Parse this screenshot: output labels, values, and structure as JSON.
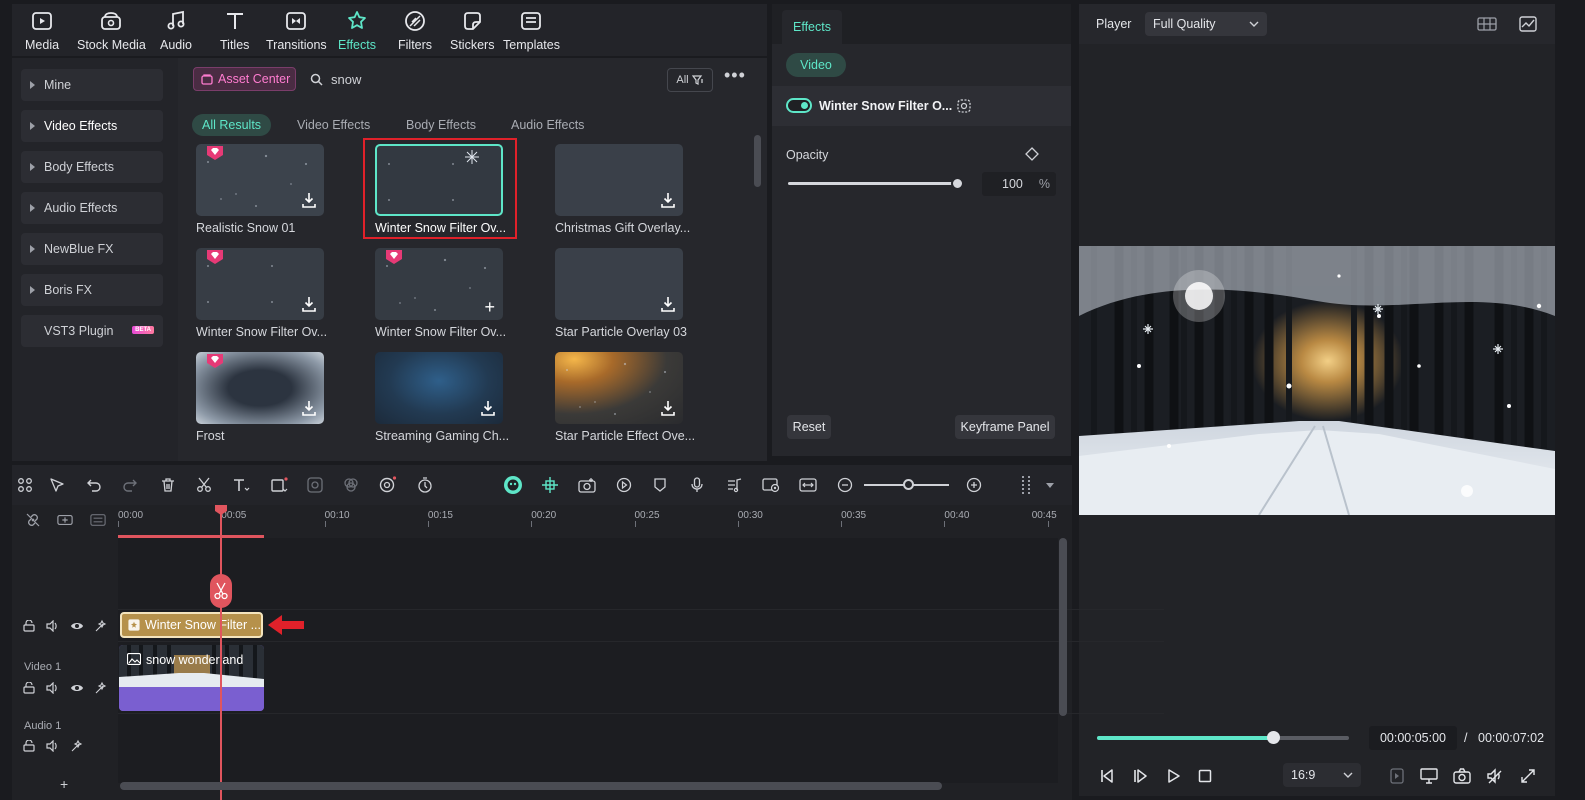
{
  "toolbar": {
    "tabs": [
      {
        "label": "Media",
        "icon": "media-icon"
      },
      {
        "label": "Stock Media",
        "icon": "stock-media-icon"
      },
      {
        "label": "Audio",
        "icon": "audio-icon"
      },
      {
        "label": "Titles",
        "icon": "titles-icon"
      },
      {
        "label": "Transitions",
        "icon": "transitions-icon"
      },
      {
        "label": "Effects",
        "icon": "effects-icon"
      },
      {
        "label": "Filters",
        "icon": "filters-icon"
      },
      {
        "label": "Stickers",
        "icon": "stickers-icon"
      },
      {
        "label": "Templates",
        "icon": "templates-icon"
      }
    ],
    "active": "Effects"
  },
  "sidebar": {
    "items": [
      {
        "label": "Mine"
      },
      {
        "label": "Video Effects"
      },
      {
        "label": "Body Effects"
      },
      {
        "label": "Audio Effects"
      },
      {
        "label": "NewBlue FX"
      },
      {
        "label": "Boris FX"
      },
      {
        "label": "VST3 Plugin",
        "badge": "BETA"
      }
    ]
  },
  "library": {
    "asset_center": "Asset Center",
    "search_value": "snow",
    "filter_label": "All",
    "filter_tabs": [
      "All Results",
      "Video Effects",
      "Body Effects",
      "Audio Effects"
    ],
    "cards": [
      {
        "label": "Realistic Snow 01",
        "premium": true,
        "action": "download"
      },
      {
        "label": "Winter Snow Filter Ov...",
        "premium": false,
        "action": "none",
        "selected": true
      },
      {
        "label": "Christmas Gift Overlay...",
        "premium": false,
        "action": "download"
      },
      {
        "label": "Winter Snow Filter Ov...",
        "premium": true,
        "action": "download"
      },
      {
        "label": "Winter Snow Filter Ov...",
        "premium": true,
        "action": "add"
      },
      {
        "label": "Star Particle Overlay 03",
        "premium": false,
        "action": "download"
      },
      {
        "label": "Frost",
        "premium": true,
        "action": "download"
      },
      {
        "label": "Streaming Gaming Ch...",
        "premium": false,
        "action": "download"
      },
      {
        "label": "Star Particle Effect Ove...",
        "premium": false,
        "action": "download"
      }
    ]
  },
  "effects_panel": {
    "tab": "Effects",
    "subtab": "Video",
    "effect_name": "Winter Snow Filter O...",
    "opacity_label": "Opacity",
    "opacity_value": "100",
    "opacity_unit": "%",
    "opacity_fraction": 1.0,
    "reset": "Reset",
    "keyframe": "Keyframe Panel"
  },
  "player": {
    "title": "Player",
    "quality": "Full Quality",
    "current_time": "00:00:05:00",
    "separator": "/",
    "total_time": "00:00:07:02",
    "progress_fraction": 0.7,
    "aspect": "16:9"
  },
  "timeline": {
    "ticks": [
      "00:00",
      "00:05",
      "00:10",
      "00:15",
      "00:20",
      "00:25",
      "00:30",
      "00:35",
      "00:40",
      "00:45"
    ],
    "effect_clip": "Winter Snow Filter ...",
    "video_clip": "snow wonderland",
    "video_track": "Video 1",
    "audio_track": "Audio 1"
  },
  "colors": {
    "accent": "#5ee6c8",
    "playhead": "#e0555e",
    "selection_box": "#e0212a",
    "effect_clip": "#b6914b",
    "asset_center": "#ff7cd0"
  }
}
